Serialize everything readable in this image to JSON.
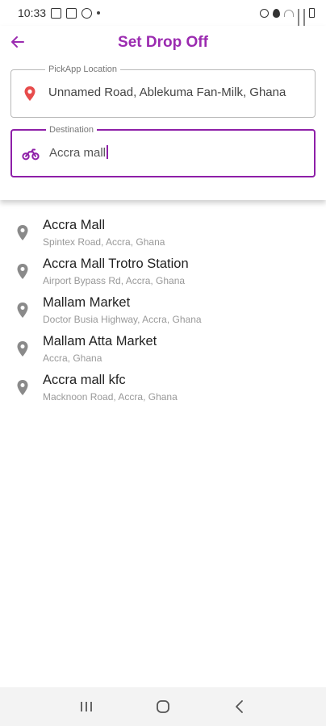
{
  "status_bar": {
    "time": "10:33"
  },
  "header": {
    "title": "Set Drop Off"
  },
  "pickup": {
    "legend": "PickApp Location",
    "value": "Unnamed Road, Ablekuma Fan-Milk, Ghana"
  },
  "destination": {
    "legend": "Destination",
    "value": "Accra mall"
  },
  "results": [
    {
      "name": "Accra Mall",
      "address": "Spintex Road, Accra, Ghana"
    },
    {
      "name": "Accra Mall Trotro Station",
      "address": "Airport Bypass Rd, Accra, Ghana"
    },
    {
      "name": "Mallam Market",
      "address": "Doctor Busia Highway, Accra, Ghana"
    },
    {
      "name": "Mallam Atta Market",
      "address": "Accra, Ghana"
    },
    {
      "name": "Accra mall kfc",
      "address": "Macknoon Road, Accra, Ghana"
    }
  ],
  "colors": {
    "accent": "#9b2bb0",
    "pin_red": "#e74c4c",
    "pin_gray": "#8a8a8a"
  },
  "icons": {
    "back": "arrow-left-icon",
    "pickup": "location-pin-icon",
    "destination": "motorbike-icon",
    "result": "location-pin-icon"
  }
}
